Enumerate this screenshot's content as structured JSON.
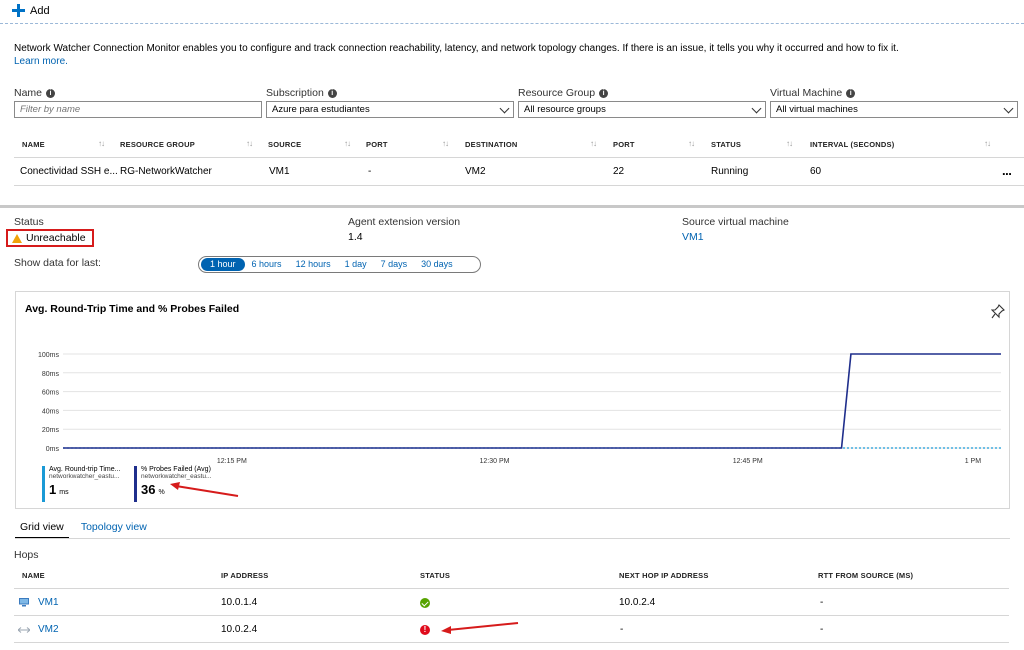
{
  "toolbar": {
    "add_label": "Add"
  },
  "description": {
    "text": "Network Watcher Connection Monitor enables you to configure and track connection reachability, latency, and network topology changes. If there is an issue, it tells you why it occurred and how to fix it.",
    "learn_more": "Learn more."
  },
  "filters": {
    "name": {
      "label": "Name",
      "placeholder": "Filter by name"
    },
    "subscription": {
      "label": "Subscription",
      "value": "Azure para estudiantes"
    },
    "resource_group": {
      "label": "Resource Group",
      "value": "All resource groups"
    },
    "virtual_machine": {
      "label": "Virtual Machine",
      "value": "All virtual machines"
    }
  },
  "monitors": {
    "columns": [
      "NAME",
      "RESOURCE GROUP",
      "SOURCE",
      "PORT",
      "DESTINATION",
      "PORT",
      "STATUS",
      "INTERVAL (SECONDS)"
    ],
    "rows": [
      {
        "name": "Conectividad SSH e...",
        "resource_group": "RG-NetworkWatcher",
        "source": "VM1",
        "source_port": "-",
        "destination": "VM2",
        "dest_port": "22",
        "status": "Running",
        "interval": "60",
        "more": "..."
      }
    ]
  },
  "details": {
    "status_label": "Status",
    "status_value": "Unreachable",
    "agent_label": "Agent extension version",
    "agent_value": "1.4",
    "source_vm_label": "Source virtual machine",
    "source_vm_value": "VM1",
    "show_data_label": "Show data for last:",
    "time_ranges": [
      "1 hour",
      "6 hours",
      "12 hours",
      "1 day",
      "7 days",
      "30 days"
    ],
    "selected_range": "1 hour"
  },
  "chart_data": {
    "type": "line",
    "title": "Avg. Round-Trip Time and % Probes Failed",
    "y_ticks": [
      "0ms",
      "20ms",
      "40ms",
      "60ms",
      "80ms",
      "100ms"
    ],
    "ylim": [
      0,
      100
    ],
    "x_ticks": [
      "12:15 PM",
      "12:30 PM",
      "12:45 PM",
      "1 PM"
    ],
    "grid": true,
    "series": [
      {
        "name": "Avg. Round-trip Time...",
        "subtitle": "networkwatcher_eastu...",
        "color": "#1a9ad6",
        "summary_value": "1",
        "summary_unit": "ms",
        "points": [
          [
            0,
            0
          ],
          [
            1,
            0
          ]
        ]
      },
      {
        "name": "% Probes Failed (Avg)",
        "subtitle": "networkwatcher_eastu...",
        "color": "#1f2e8c",
        "summary_value": "36",
        "summary_unit": "%",
        "points": [
          [
            0,
            0
          ],
          [
            0.83,
            0
          ],
          [
            0.84,
            100
          ],
          [
            1,
            100
          ]
        ]
      }
    ]
  },
  "view_tabs": {
    "grid": "Grid view",
    "topology": "Topology view"
  },
  "hops": {
    "title": "Hops",
    "columns": [
      "NAME",
      "IP ADDRESS",
      "STATUS",
      "NEXT HOP IP ADDRESS",
      "RTT FROM SOURCE (MS)"
    ],
    "rows": [
      {
        "name": "VM1",
        "ip": "10.0.1.4",
        "status": "ok",
        "next_hop": "10.0.2.4",
        "rtt": "-"
      },
      {
        "name": "VM2",
        "ip": "10.0.2.4",
        "status": "error",
        "next_hop": "-",
        "rtt": "-"
      }
    ]
  },
  "colors": {
    "accent": "#0063b1",
    "annotation_red": "#d61b1b",
    "warning": "#f0a30a"
  }
}
